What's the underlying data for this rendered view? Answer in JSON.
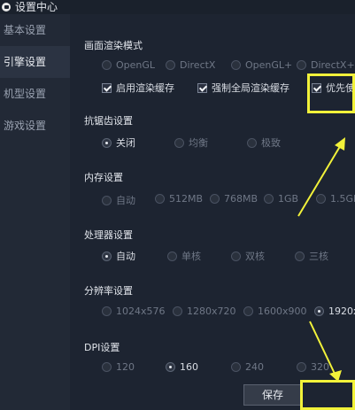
{
  "window": {
    "title": "设置中心"
  },
  "sidebar": {
    "items": [
      {
        "label": "基本设置",
        "active": false
      },
      {
        "label": "引擎设置",
        "active": true
      },
      {
        "label": "机型设置",
        "active": false
      },
      {
        "label": "游戏设置",
        "active": false
      }
    ]
  },
  "render": {
    "title": "画面渲染模式",
    "modes": [
      "OpenGL",
      "DirectX",
      "OpenGL+",
      "DirectX+"
    ],
    "checkboxes": [
      "启用渲染缓存",
      "强制全局渲染缓存",
      "优先使"
    ]
  },
  "antialias": {
    "title": "抗锯齿设置",
    "options": [
      "关闭",
      "均衡",
      "极致"
    ],
    "selected": "关闭"
  },
  "memory": {
    "title": "内存设置",
    "options": [
      "自动",
      "512MB",
      "768MB",
      "1GB",
      "1.5GB"
    ],
    "selected": ""
  },
  "cpu": {
    "title": "处理器设置",
    "options": [
      "自动",
      "单核",
      "双核",
      "三核"
    ],
    "selected": "自动"
  },
  "resolution": {
    "title": "分辨率设置",
    "options": [
      "1024x576",
      "1280x720",
      "1600x900",
      "1920x"
    ],
    "selected": "1920x"
  },
  "dpi": {
    "title": "DPI设置",
    "options": [
      "120",
      "160",
      "240",
      "320"
    ],
    "selected": "160"
  },
  "footer": {
    "save_label": "保存"
  },
  "colors": {
    "highlight": "#f2f23a",
    "background": "#1d2431",
    "sidebar": "#222936"
  }
}
